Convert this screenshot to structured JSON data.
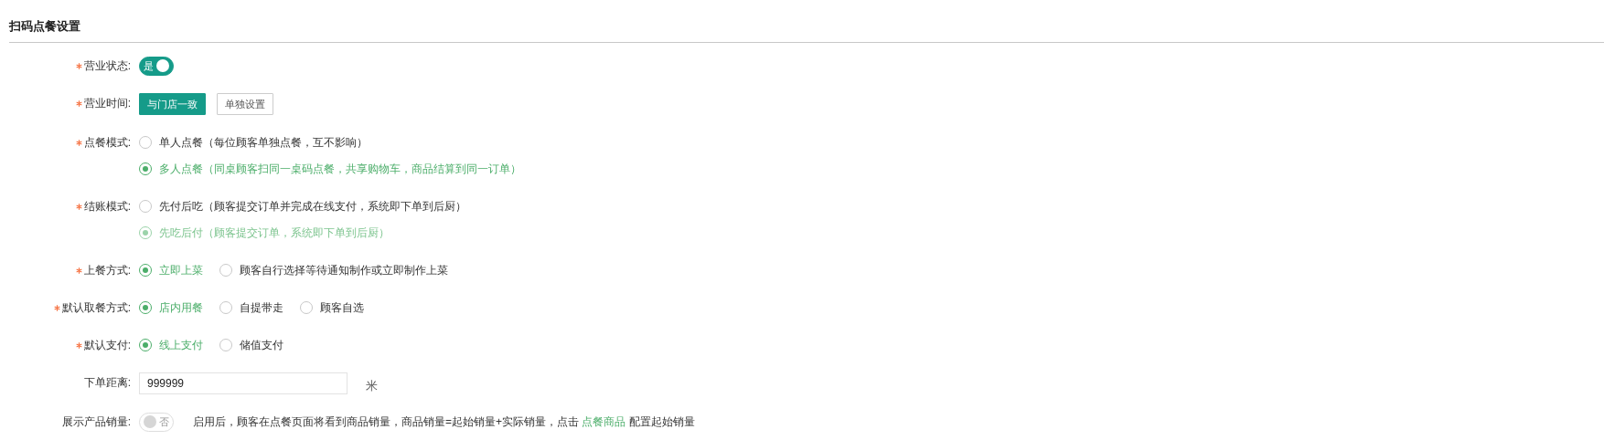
{
  "title": "扫码点餐设置",
  "fields": [
    {
      "kind": "toggle",
      "label": "营业状态:",
      "required": true,
      "on": true,
      "text": "是"
    },
    {
      "kind": "buttons",
      "label": "营业时间:",
      "required": true,
      "buttons": [
        {
          "label": "与门店一致",
          "selected": true
        },
        {
          "label": "单独设置",
          "selected": false
        }
      ]
    },
    {
      "kind": "radio_stack",
      "label": "点餐模式:",
      "required": true,
      "options": [
        {
          "label": "单人点餐（每位顾客单独点餐，互不影响）",
          "selected": false,
          "disabled": false
        },
        {
          "label": "多人点餐（同桌顾客扫同一桌码点餐，共享购物车，商品结算到同一订单）",
          "selected": true,
          "disabled": false
        }
      ]
    },
    {
      "kind": "radio_stack",
      "label": "结账模式:",
      "required": true,
      "options": [
        {
          "label": "先付后吃（顾客提交订单并完成在线支付，系统即下单到后厨）",
          "selected": false,
          "disabled": false
        },
        {
          "label": "先吃后付（顾客提交订单，系统即下单到后厨）",
          "selected": true,
          "disabled": true
        }
      ]
    },
    {
      "kind": "radio",
      "label": "上餐方式:",
      "required": true,
      "options": [
        {
          "label": "立即上菜",
          "selected": true,
          "disabled": false
        },
        {
          "label": "顾客自行选择等待通知制作或立即制作上菜",
          "selected": false,
          "disabled": false
        }
      ]
    },
    {
      "kind": "radio",
      "label": "默认取餐方式:",
      "required": true,
      "options": [
        {
          "label": "店内用餐",
          "selected": true,
          "disabled": false
        },
        {
          "label": "自提带走",
          "selected": false,
          "disabled": false
        },
        {
          "label": "顾客自选",
          "selected": false,
          "disabled": false
        }
      ]
    },
    {
      "kind": "radio",
      "label": "默认支付:",
      "required": true,
      "options": [
        {
          "label": "线上支付",
          "selected": true,
          "disabled": false
        },
        {
          "label": "储值支付",
          "selected": false,
          "disabled": false
        }
      ]
    },
    {
      "kind": "input",
      "label": "下单距离:",
      "required": false,
      "value": "999999",
      "unit": "米"
    },
    {
      "kind": "toggle",
      "label": "展示产品销量:",
      "required": false,
      "on": false,
      "text": "否",
      "note": "启用后，顾客在点餐页面将看到商品销量，商品销量=起始销量+实际销量，点击",
      "link": "点餐商品",
      "note_after": "配置起始销量"
    }
  ]
}
